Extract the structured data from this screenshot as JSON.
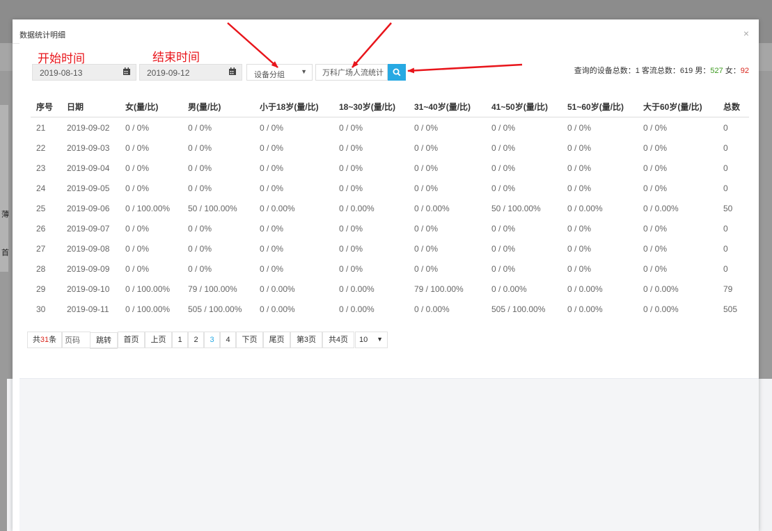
{
  "background": {
    "side_glyphs": [
      "",
      "薄",
      "首"
    ]
  },
  "modal": {
    "title": "数据统计明细",
    "close_label": "×"
  },
  "annotations": {
    "start_label": "开始时间",
    "end_label": "结束时间",
    "arrow_color": "#e8151b"
  },
  "filters": {
    "start_date": "2019-08-13",
    "end_date": "2019-09-12",
    "device_group": "设备分组",
    "device_group_caret": "▼",
    "device_name_value": "万科广场人流统计"
  },
  "summary": {
    "devices_label": "查询的设备总数：",
    "devices_value": "1",
    "traffic_label": "客流总数：",
    "traffic_value": "619",
    "male_label": "男：",
    "male_value": "527",
    "female_label": "女：",
    "female_value": "92"
  },
  "table": {
    "headers": [
      "序号",
      "日期",
      "女(量/比)",
      "男(量/比)",
      "小于18岁(量/比)",
      "18~30岁(量/比)",
      "31~40岁(量/比)",
      "41~50岁(量/比)",
      "51~60岁(量/比)",
      "大于60岁(量/比)",
      "总数"
    ],
    "rows": [
      [
        "21",
        "2019-09-02",
        "0 / 0%",
        "0 / 0%",
        "0 / 0%",
        "0 / 0%",
        "0 / 0%",
        "0 / 0%",
        "0 / 0%",
        "0 / 0%",
        "0"
      ],
      [
        "22",
        "2019-09-03",
        "0 / 0%",
        "0 / 0%",
        "0 / 0%",
        "0 / 0%",
        "0 / 0%",
        "0 / 0%",
        "0 / 0%",
        "0 / 0%",
        "0"
      ],
      [
        "23",
        "2019-09-04",
        "0 / 0%",
        "0 / 0%",
        "0 / 0%",
        "0 / 0%",
        "0 / 0%",
        "0 / 0%",
        "0 / 0%",
        "0 / 0%",
        "0"
      ],
      [
        "24",
        "2019-09-05",
        "0 / 0%",
        "0 / 0%",
        "0 / 0%",
        "0 / 0%",
        "0 / 0%",
        "0 / 0%",
        "0 / 0%",
        "0 / 0%",
        "0"
      ],
      [
        "25",
        "2019-09-06",
        "0 / 100.00%",
        "50 / 100.00%",
        "0 / 0.00%",
        "0 / 0.00%",
        "0 / 0.00%",
        "50 / 100.00%",
        "0 / 0.00%",
        "0 / 0.00%",
        "50"
      ],
      [
        "26",
        "2019-09-07",
        "0 / 0%",
        "0 / 0%",
        "0 / 0%",
        "0 / 0%",
        "0 / 0%",
        "0 / 0%",
        "0 / 0%",
        "0 / 0%",
        "0"
      ],
      [
        "27",
        "2019-09-08",
        "0 / 0%",
        "0 / 0%",
        "0 / 0%",
        "0 / 0%",
        "0 / 0%",
        "0 / 0%",
        "0 / 0%",
        "0 / 0%",
        "0"
      ],
      [
        "28",
        "2019-09-09",
        "0 / 0%",
        "0 / 0%",
        "0 / 0%",
        "0 / 0%",
        "0 / 0%",
        "0 / 0%",
        "0 / 0%",
        "0 / 0%",
        "0"
      ],
      [
        "29",
        "2019-09-10",
        "0 / 100.00%",
        "79 / 100.00%",
        "0 / 0.00%",
        "0 / 0.00%",
        "79 / 100.00%",
        "0 / 0.00%",
        "0 / 0.00%",
        "0 / 0.00%",
        "79"
      ],
      [
        "30",
        "2019-09-11",
        "0 / 100.00%",
        "505 / 100.00%",
        "0 / 0.00%",
        "0 / 0.00%",
        "0 / 0.00%",
        "505 / 100.00%",
        "0 / 0.00%",
        "0 / 0.00%",
        "505"
      ]
    ]
  },
  "pagination": {
    "total_prefix": "共",
    "total_count": "31",
    "total_suffix": "条",
    "page_input_placeholder": "页码",
    "jump_label": "跳转",
    "first_label": "首页",
    "prev_label": "上页",
    "pages": [
      "1",
      "2",
      "3",
      "4"
    ],
    "current_page": "3",
    "next_label": "下页",
    "last_label": "尾页",
    "current_page_label": "第3页",
    "total_pages_label": "共4页",
    "page_size": "10",
    "page_size_caret": "▼"
  },
  "colors": {
    "accent": "#27a9e3",
    "annotation_red": "#e8151b",
    "male_green": "#3c9a1f",
    "female_red": "#d9261c"
  }
}
